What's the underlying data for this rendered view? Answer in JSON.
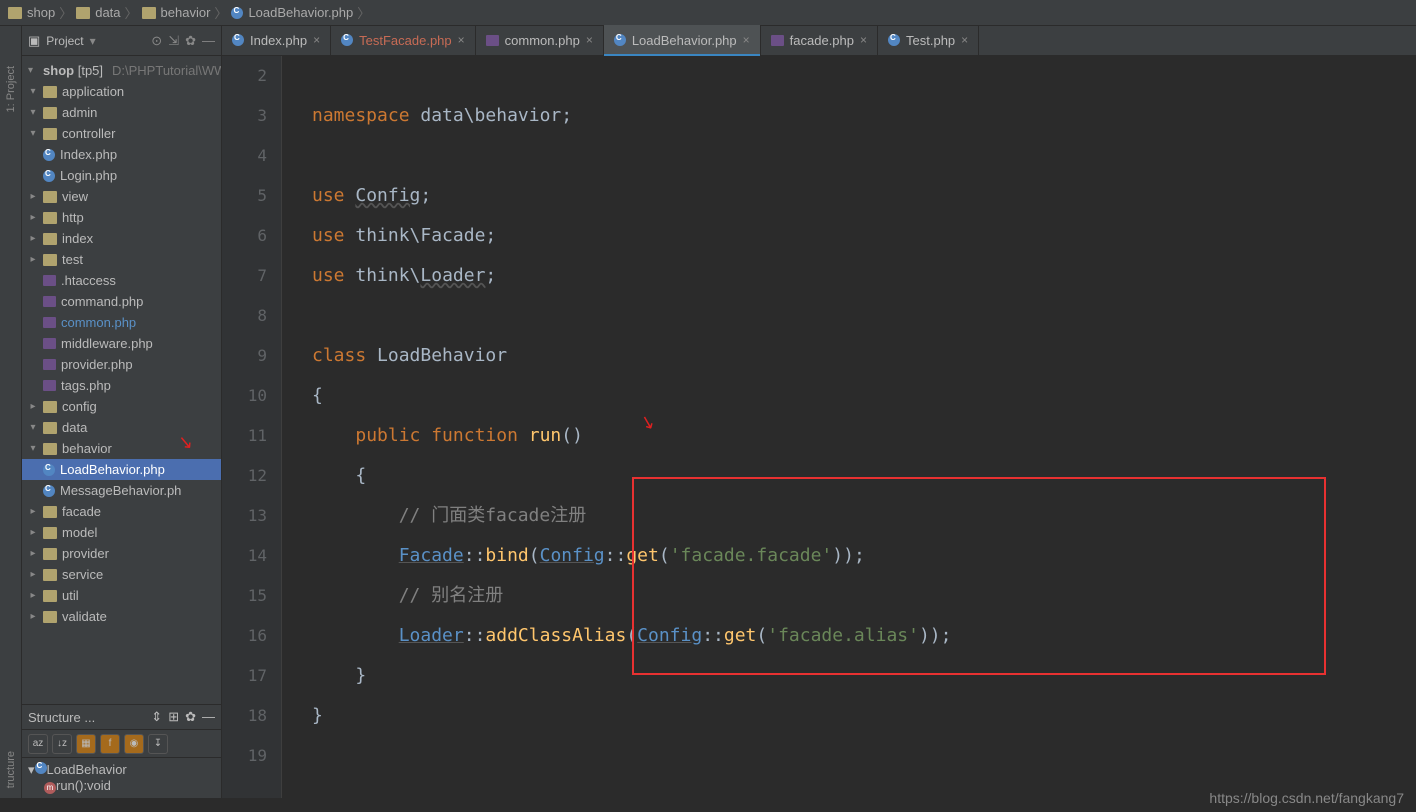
{
  "breadcrumbs": [
    "shop",
    "data",
    "behavior",
    "LoadBehavior.php"
  ],
  "sidebar": {
    "title": "Project",
    "root_name": "shop",
    "root_tag": "[tp5]",
    "root_hint": "D:\\PHPTutorial\\WW",
    "items": {
      "application": "application",
      "admin": "admin",
      "controller": "controller",
      "index_php": "Index.php",
      "login_php": "Login.php",
      "view": "view",
      "http": "http",
      "index": "index",
      "test": "test",
      "htaccess": ".htaccess",
      "command": "command.php",
      "common": "common.php",
      "middleware": "middleware.php",
      "provider": "provider.php",
      "tags": "tags.php",
      "config": "config",
      "data": "data",
      "behavior": "behavior",
      "loadbehavior": "LoadBehavior.php",
      "messagebehavior": "MessageBehavior.ph",
      "facade": "facade",
      "model": "model",
      "provider_dir": "provider",
      "service": "service",
      "util": "util",
      "validate": "validate"
    }
  },
  "structure": {
    "title": "Structure ...",
    "class": "LoadBehavior",
    "method": "run():void"
  },
  "tabs": [
    {
      "label": "Index.php",
      "active": false,
      "red": false
    },
    {
      "label": "TestFacade.php",
      "active": false,
      "red": true
    },
    {
      "label": "common.php",
      "active": false,
      "red": false,
      "icon": "php2"
    },
    {
      "label": "LoadBehavior.php",
      "active": true,
      "red": false
    },
    {
      "label": "facade.php",
      "active": false,
      "red": false,
      "icon": "php2"
    },
    {
      "label": "Test.php",
      "active": false,
      "red": false
    }
  ],
  "code": {
    "lines": [
      {
        "n": 2,
        "html": ""
      },
      {
        "n": 3,
        "tokens": [
          [
            "kw",
            "namespace "
          ],
          [
            "cls",
            "data\\behavior"
          ],
          [
            "cls",
            ";"
          ]
        ]
      },
      {
        "n": 4,
        "html": ""
      },
      {
        "n": 5,
        "tokens": [
          [
            "kw",
            "use "
          ],
          [
            "underln",
            "Config"
          ],
          [
            "cls",
            ";"
          ]
        ]
      },
      {
        "n": 6,
        "tokens": [
          [
            "kw",
            "use "
          ],
          [
            "cls",
            "think\\Facade;"
          ]
        ]
      },
      {
        "n": 7,
        "tokens": [
          [
            "kw",
            "use "
          ],
          [
            "cls",
            "think\\"
          ],
          [
            "underln",
            "Loader"
          ],
          [
            "cls",
            ";"
          ]
        ]
      },
      {
        "n": 8,
        "html": ""
      },
      {
        "n": 9,
        "tokens": [
          [
            "kw",
            "class "
          ],
          [
            "cls",
            "LoadBehavior"
          ]
        ]
      },
      {
        "n": 10,
        "tokens": [
          [
            "cls",
            "{"
          ]
        ]
      },
      {
        "n": 11,
        "tokens": [
          [
            "cls",
            "    "
          ],
          [
            "kw",
            "public function "
          ],
          [
            "fn",
            "run"
          ],
          [
            "cls",
            "("
          ],
          [
            "cls",
            ")"
          ]
        ]
      },
      {
        "n": 12,
        "tokens": [
          [
            "cls",
            "    {"
          ]
        ]
      },
      {
        "n": 13,
        "tokens": [
          [
            "cls",
            "        "
          ],
          [
            "com",
            "// 门面类facade注册"
          ]
        ]
      },
      {
        "n": 14,
        "tokens": [
          [
            "cls",
            "        "
          ],
          [
            "link",
            "Facade"
          ],
          [
            "cls",
            "::"
          ],
          [
            "fn",
            "bind"
          ],
          [
            "cls",
            "("
          ],
          [
            "link",
            "Config"
          ],
          [
            "cls",
            "::"
          ],
          [
            "fn",
            "get"
          ],
          [
            "cls",
            "("
          ],
          [
            "str",
            "'facade.facade'"
          ],
          [
            "cls",
            "));"
          ]
        ]
      },
      {
        "n": 15,
        "tokens": [
          [
            "cls",
            "        "
          ],
          [
            "com",
            "// 别名注册"
          ]
        ]
      },
      {
        "n": 16,
        "tokens": [
          [
            "cls",
            "        "
          ],
          [
            "link",
            "Loader"
          ],
          [
            "cls",
            "::"
          ],
          [
            "fn",
            "addClassAlias"
          ],
          [
            "cls",
            "("
          ],
          [
            "link",
            "Config"
          ],
          [
            "cls",
            "::"
          ],
          [
            "fn",
            "get"
          ],
          [
            "cls",
            "("
          ],
          [
            "str",
            "'facade.alias'"
          ],
          [
            "cls",
            "));"
          ]
        ]
      },
      {
        "n": 17,
        "tokens": [
          [
            "cls",
            "    }"
          ]
        ]
      },
      {
        "n": 18,
        "tokens": [
          [
            "cls",
            "}"
          ]
        ]
      },
      {
        "n": 19,
        "html": ""
      }
    ]
  },
  "watermark": "https://blog.csdn.net/fangkang7"
}
